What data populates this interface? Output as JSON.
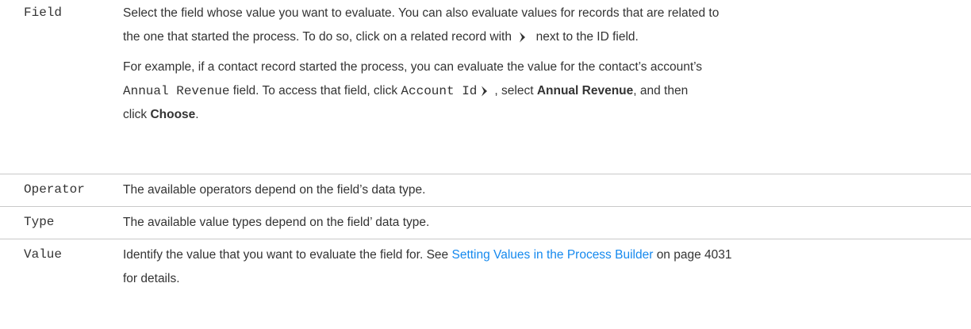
{
  "rows": [
    {
      "term": "Field",
      "para1": {
        "line1": "Select the field whose value you want to evaluate. You can also evaluate values for records that are related to",
        "line2_before": "the one that started the process. To do so, click on a related record with",
        "line2_after": "next to the ID field."
      },
      "para2": {
        "line1": "For example, if a contact record started the process, you can evaluate the value for the contact’s account’s",
        "annual_revenue_code": "Annual Revenue",
        "line2_middle": "field. To access that field, click",
        "account_id_code": "Account Id",
        "line2_after": ", select",
        "annual_revenue_bold": "Annual Revenue",
        "line2_end": ", and then",
        "line3_before": "click",
        "choose_bold": "Choose",
        "line3_end": "."
      },
      "icon": "chevron-right-icon"
    },
    {
      "term": "Operator",
      "desc": "The available operators depend on the field’s data type."
    },
    {
      "term": "Type",
      "desc": "The available value types depend on the field’ data type."
    },
    {
      "term": "Value",
      "desc_before": "Identify the value that you want to evaluate the field for. See",
      "link_text": "Setting Values in the Process Builder",
      "desc_after": "on page 4031",
      "desc_line2": "for details."
    }
  ],
  "colors": {
    "text": "#333333",
    "link": "#1589ee",
    "divider": "#c9c9c9"
  }
}
